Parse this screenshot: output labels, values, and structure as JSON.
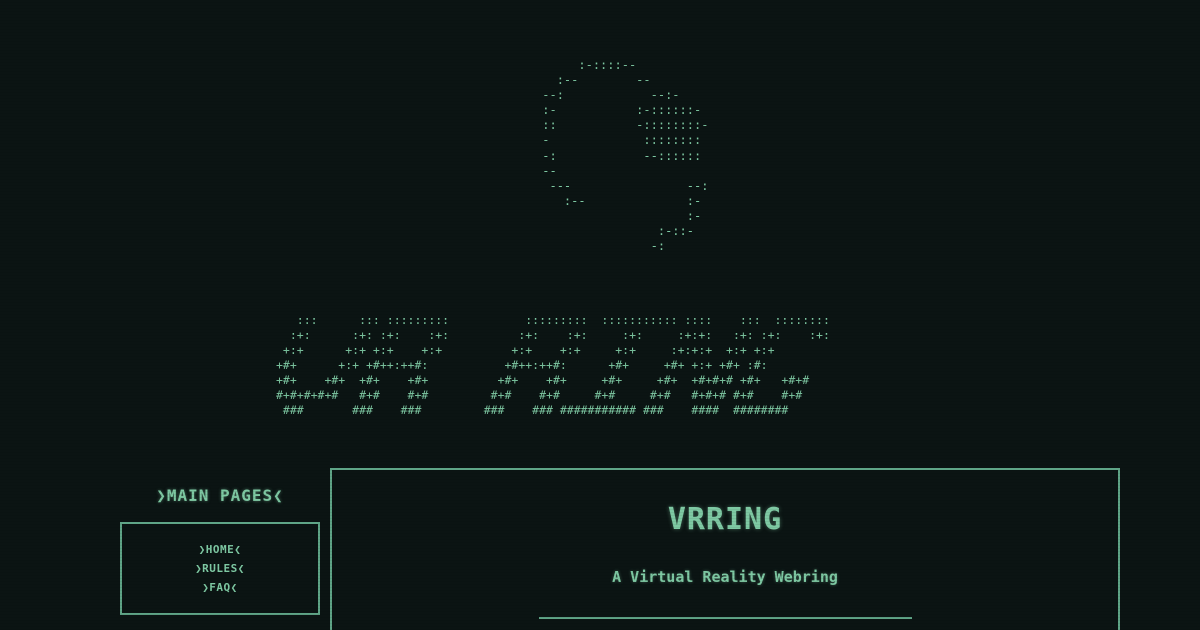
{
  "logo": {
    "ascii": "               :-::::--\n            :--        --\n          --:            --:-\n          :-           :-::::::-\n          ::           -::::::::-\n          -             ::::::::\n          -:            --::::::\n          --\n           ---                --:\n             :--              :-\n                              :-\n                          :-::-\n                         -:"
  },
  "banner": {
    "ascii": "   :::      ::: :::::::::           :::::::::  ::::::::::: ::::    :::  ::::::::\n  :+:      :+: :+:    :+:          :+:    :+:     :+:     :+:+:   :+: :+:    :+:\n +:+      +:+ +:+    +:+          +:+    +:+     +:+     :+:+:+  +:+ +:+\n+#+      +:+ +#++:++#:           +#++:++#:      +#+     +#+ +:+ +#+ :#:\n+#+    +#+  +#+    +#+          +#+    +#+     +#+     +#+  +#+#+# +#+   +#+#\n#+#+#+#+#   #+#    #+#         #+#    #+#     #+#     #+#   #+#+# #+#    #+#\n ###       ###    ###         ###    ### ########### ###    ####  ########"
  },
  "sidebar": {
    "heading": "❯MAIN PAGES❮",
    "links": [
      {
        "label": "❯HOME❮"
      },
      {
        "label": "❯RULES❮"
      },
      {
        "label": "❯FAQ❮"
      }
    ]
  },
  "main": {
    "title": "VRRING",
    "subtitle": "A Virtual Reality Webring"
  },
  "colors": {
    "background": "#0b1413",
    "text": "#7ec9a3",
    "border": "#5fa587"
  }
}
